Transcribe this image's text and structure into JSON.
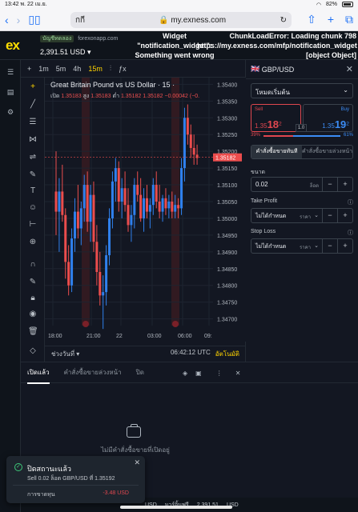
{
  "status": {
    "time": "13:42",
    "date": "พ. 22 เม.ย.",
    "wifi_icon": "wifi-icon",
    "battery": "82%"
  },
  "browser": {
    "tab_text": "กกี",
    "domain": "my.exness.com",
    "lock_icon": "lock-icon"
  },
  "header": {
    "logo": "ex",
    "account_tag": "บัญชีทดลอง",
    "account_site": "forexonapp.com",
    "balance": "2,391.51 USD",
    "error_left": "Widget \"notification_widget\": Something went wrong",
    "error_right": "ChunkLoadError: Loading chunk 798 https://my.exness.com/mfp/notification_widget [object Object]"
  },
  "chart_toolbar": {
    "add": "+",
    "tf": [
      "1m",
      "5m",
      "4h",
      "15m"
    ],
    "active_tf": "15m"
  },
  "chart": {
    "title": "Great Britain Pound vs US Dollar · 15 ·",
    "ohlc": {
      "o_label": "เปิด",
      "o": "1.35183",
      "h_label": "สูง",
      "h": "1.35183",
      "l_label": "ต่ำ",
      "l": "1.35182",
      "c": "1.35182",
      "chg": "−0.00042 (−0."
    },
    "price_tag": "1.35182",
    "range_label": "ช่วงวันที่",
    "clock": "06:42:12 UTC",
    "auto": "อัตโนมัติ"
  },
  "chart_data": {
    "type": "candlestick",
    "title": "Great Britain Pound vs US Dollar · 15",
    "y_ticks": [
      "1.35400",
      "1.35350",
      "1.35300",
      "1.35250",
      "1.35200",
      "1.35150",
      "1.35100",
      "1.35050",
      "1.35000",
      "1.34950",
      "1.34900",
      "1.34850",
      "1.34800",
      "1.34750",
      "1.34700"
    ],
    "x_ticks": [
      "18:00",
      "21:00",
      "22",
      "03:00",
      "06:00",
      "09:"
    ],
    "ylim": [
      1.3468,
      1.3542
    ],
    "last_price": 1.35182,
    "candles": [
      [
        1.3508,
        1.352,
        1.3495,
        1.3502
      ],
      [
        1.3502,
        1.3512,
        1.349,
        1.3508
      ],
      [
        1.3508,
        1.3516,
        1.3499,
        1.3501
      ],
      [
        1.3501,
        1.3503,
        1.3482,
        1.3487
      ],
      [
        1.3487,
        1.3492,
        1.3477,
        1.348
      ],
      [
        1.348,
        1.3497,
        1.3478,
        1.3494
      ],
      [
        1.3494,
        1.3506,
        1.349,
        1.3502
      ],
      [
        1.3502,
        1.351,
        1.3494,
        1.3497
      ],
      [
        1.3497,
        1.3505,
        1.3492,
        1.3503
      ],
      [
        1.3503,
        1.3513,
        1.3499,
        1.351
      ],
      [
        1.351,
        1.3514,
        1.3496,
        1.3499
      ],
      [
        1.3499,
        1.351,
        1.3493,
        1.3507
      ],
      [
        1.3507,
        1.3511,
        1.349,
        1.3493
      ],
      [
        1.3493,
        1.3498,
        1.348,
        1.3484
      ],
      [
        1.3484,
        1.349,
        1.3474,
        1.3477
      ],
      [
        1.3477,
        1.3483,
        1.3467,
        1.3478
      ],
      [
        1.3478,
        1.3492,
        1.3474,
        1.3489
      ],
      [
        1.3489,
        1.3503,
        1.3486,
        1.35
      ],
      [
        1.35,
        1.3514,
        1.3497,
        1.3511
      ],
      [
        1.3511,
        1.3518,
        1.3505,
        1.3515
      ],
      [
        1.3515,
        1.3517,
        1.3502,
        1.3505
      ],
      [
        1.3505,
        1.3512,
        1.35,
        1.3509
      ],
      [
        1.3509,
        1.3514,
        1.3502,
        1.3504
      ],
      [
        1.3504,
        1.3509,
        1.3496,
        1.3498
      ],
      [
        1.3498,
        1.3504,
        1.3493,
        1.3501
      ],
      [
        1.3501,
        1.3512,
        1.3497,
        1.351
      ],
      [
        1.351,
        1.3514,
        1.3505,
        1.3507
      ],
      [
        1.3507,
        1.3512,
        1.3499,
        1.35
      ],
      [
        1.35,
        1.3509,
        1.3496,
        1.3506
      ],
      [
        1.3506,
        1.351,
        1.35,
        1.3502
      ],
      [
        1.3502,
        1.3506,
        1.3497,
        1.3504
      ],
      [
        1.3504,
        1.3512,
        1.3501,
        1.351
      ],
      [
        1.351,
        1.3514,
        1.3503,
        1.3505
      ],
      [
        1.3505,
        1.351,
        1.35,
        1.3502
      ],
      [
        1.3502,
        1.3507,
        1.3499,
        1.3506
      ],
      [
        1.3506,
        1.3509,
        1.3501,
        1.3503
      ],
      [
        1.3503,
        1.3507,
        1.35,
        1.3505
      ],
      [
        1.3505,
        1.3508,
        1.35,
        1.3502
      ],
      [
        1.3502,
        1.3507,
        1.35,
        1.3504
      ],
      [
        1.3504,
        1.3506,
        1.35,
        1.3503
      ],
      [
        1.3503,
        1.3518,
        1.3501,
        1.3515
      ],
      [
        1.3515,
        1.3533,
        1.3511,
        1.353
      ],
      [
        1.353,
        1.3534,
        1.3522,
        1.3525
      ],
      [
        1.3525,
        1.3528,
        1.3518,
        1.3521
      ],
      [
        1.3521,
        1.3525,
        1.3516,
        1.3519
      ],
      [
        1.3519,
        1.3522,
        1.3516,
        1.3518
      ]
    ]
  },
  "right_panel": {
    "symbol": "GBP/USD",
    "order_type": "โหมดเริ่มต้น",
    "sell_label": "Sell",
    "sell_price": "1.35",
    "sell_big": "18",
    "sell_sup": "2",
    "buy_label": "Buy",
    "buy_price": "1.35",
    "buy_big": "19",
    "buy_sup": "2",
    "spread": "1.0",
    "sell_pct": "39%",
    "buy_pct": "61%",
    "sell_ratio": 0.39,
    "tab_market": "คำสั่งซื้อขายทันที",
    "tab_pending": "คำสั่งซื้อขายล่วงหน้า",
    "volume_label": "ขนาด",
    "volume": "0.02",
    "volume_unit": "ล็อต",
    "tp_label": "Take Profit",
    "tp_value": "ไม่ได้กำหนด",
    "tp_unit": "ราคา",
    "sl_label": "Stop Loss",
    "sl_value": "ไม่ได้กำหนด",
    "sl_unit": "ราคา",
    "minus": "−",
    "plus": "+"
  },
  "orders": {
    "tab_open": "เปิดแล้ว",
    "tab_pending": "คำสั่งซื้อขายล่วงหน้า",
    "tab_closed": "ปิด",
    "empty_text": "ไม่มีคำสั่งซื้อขายที่เปิดอยู่"
  },
  "footer": {
    "left": "USD",
    "equity_label": "มาร์จิ้นฟรี",
    "equity": "2,391.51",
    "unit": "USD"
  },
  "toast": {
    "title": "ปิดสถานะแล้ว",
    "desc": "Sell 0.02 ล็อต GBP/USD ที่ 1.35192",
    "pl_label": "การขาดทุน",
    "pl_value": "-3.48 USD"
  }
}
